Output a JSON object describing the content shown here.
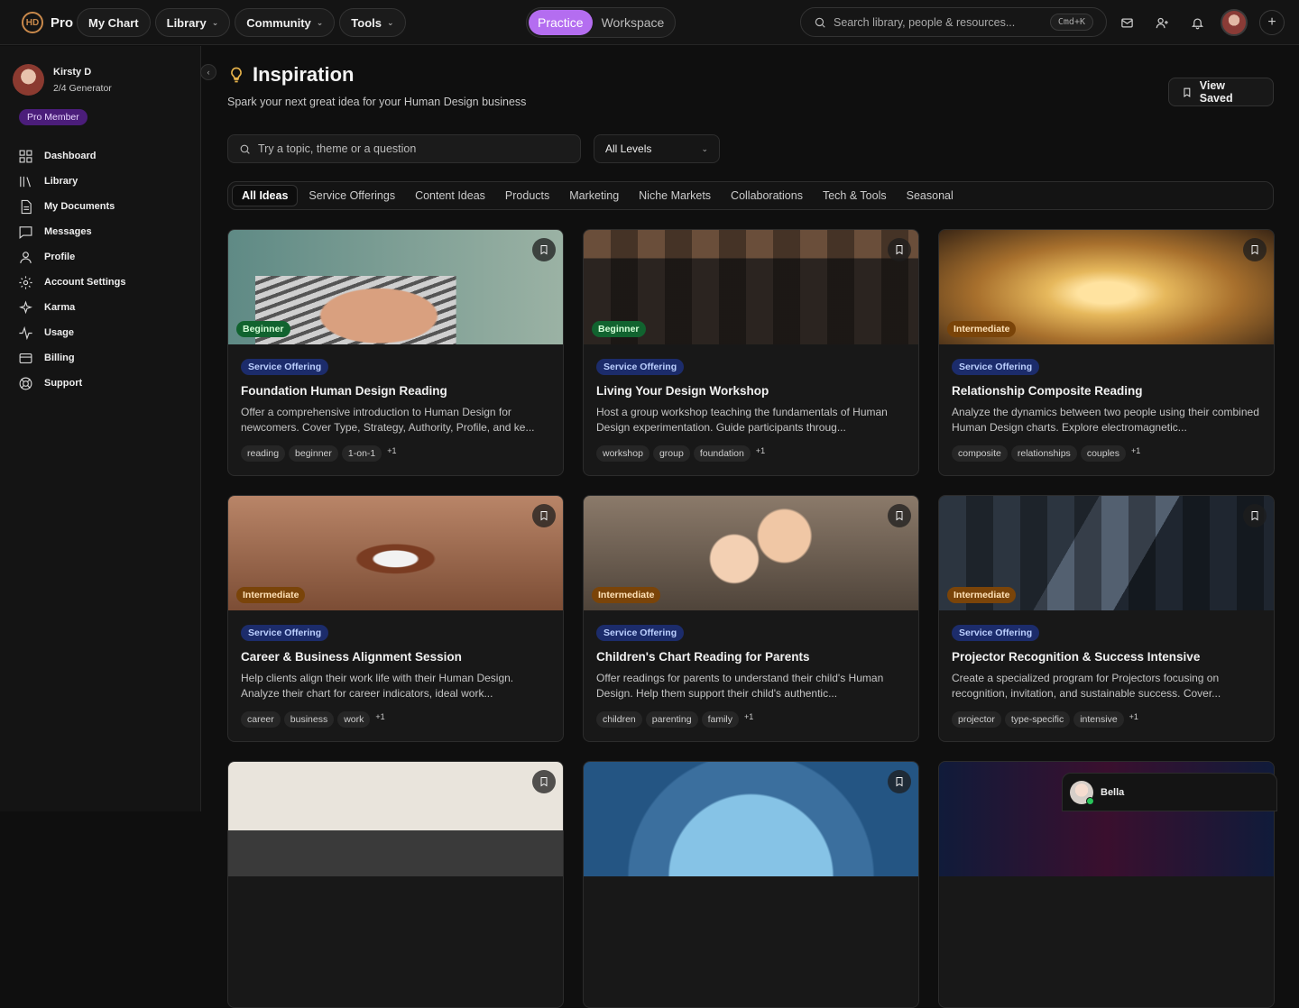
{
  "brand": {
    "logo_text": "Pro",
    "logo_mark": "HD"
  },
  "topnav": [
    {
      "label": "My Chart",
      "dropdown": false
    },
    {
      "label": "Library",
      "dropdown": true
    },
    {
      "label": "Community",
      "dropdown": true
    },
    {
      "label": "Tools",
      "dropdown": true
    }
  ],
  "mode_switch": {
    "options": [
      "Practice",
      "Workspace"
    ],
    "active": "Practice"
  },
  "search": {
    "placeholder": "Search library, people & resources...",
    "shortcut": "Cmd+K"
  },
  "top_icons": [
    "mail-icon",
    "add-user-icon",
    "bell-icon",
    "avatar",
    "plus-icon"
  ],
  "user": {
    "name": "Kirsty D",
    "type": "2/4 Generator",
    "badge": "Pro Member"
  },
  "sidebar": {
    "items": [
      {
        "label": "Dashboard",
        "icon": "dashboard-icon"
      },
      {
        "label": "Library",
        "icon": "library-icon"
      },
      {
        "label": "My Documents",
        "icon": "document-icon"
      },
      {
        "label": "Messages",
        "icon": "message-icon"
      },
      {
        "label": "Profile",
        "icon": "user-icon"
      },
      {
        "label": "Account Settings",
        "icon": "gear-icon"
      },
      {
        "label": "Karma",
        "icon": "sparkle-icon"
      },
      {
        "label": "Usage",
        "icon": "activity-icon"
      },
      {
        "label": "Billing",
        "icon": "card-icon"
      },
      {
        "label": "Support",
        "icon": "lifebuoy-icon"
      }
    ]
  },
  "page": {
    "title": "Inspiration",
    "subtitle": "Spark your next great idea for your Human Design business",
    "view_saved_label": "View Saved",
    "topic_placeholder": "Try a topic, theme or a question",
    "level_select": "All Levels",
    "tabs": [
      "All Ideas",
      "Service Offerings",
      "Content Ideas",
      "Products",
      "Marketing",
      "Niche Markets",
      "Collaborations",
      "Tech & Tools",
      "Seasonal"
    ],
    "active_tab": "All Ideas"
  },
  "cards": [
    {
      "level": "Beginner",
      "category": "Service Offering",
      "title": "Foundation Human Design Reading",
      "desc": "Offer a comprehensive introduction to Human Design for newcomers. Cover Type, Strategy, Authority, Profile, and ke...",
      "tags": [
        "reading",
        "beginner",
        "1-on-1"
      ],
      "more": "+1"
    },
    {
      "level": "Beginner",
      "category": "Service Offering",
      "title": "Living Your Design Workshop",
      "desc": "Host a group workshop teaching the fundamentals of Human Design experimentation. Guide participants throug...",
      "tags": [
        "workshop",
        "group",
        "foundation"
      ],
      "more": "+1"
    },
    {
      "level": "Intermediate",
      "category": "Service Offering",
      "title": "Relationship Composite Reading",
      "desc": "Analyze the dynamics between two people using their combined Human Design charts. Explore electromagnetic...",
      "tags": [
        "composite",
        "relationships",
        "couples"
      ],
      "more": "+1"
    },
    {
      "level": "Intermediate",
      "category": "Service Offering",
      "title": "Career & Business Alignment Session",
      "desc": "Help clients align their work life with their Human Design. Analyze their chart for career indicators, ideal work...",
      "tags": [
        "career",
        "business",
        "work"
      ],
      "more": "+1"
    },
    {
      "level": "Intermediate",
      "category": "Service Offering",
      "title": "Children's Chart Reading for Parents",
      "desc": "Offer readings for parents to understand their child's Human Design. Help them support their child's authentic...",
      "tags": [
        "children",
        "parenting",
        "family"
      ],
      "more": "+1"
    },
    {
      "level": "Intermediate",
      "category": "Service Offering",
      "title": "Projector Recognition & Success Intensive",
      "desc": "Create a specialized program for Projectors focusing on recognition, invitation, and sustainable success. Cover...",
      "tags": [
        "projector",
        "type-specific",
        "intensive"
      ],
      "more": "+1"
    }
  ],
  "chat": {
    "name": "Bella"
  },
  "colors": {
    "accent": "#b46df0",
    "beginner": "#11632f",
    "intermediate": "#7a4409",
    "category": "#1c2c6b"
  }
}
